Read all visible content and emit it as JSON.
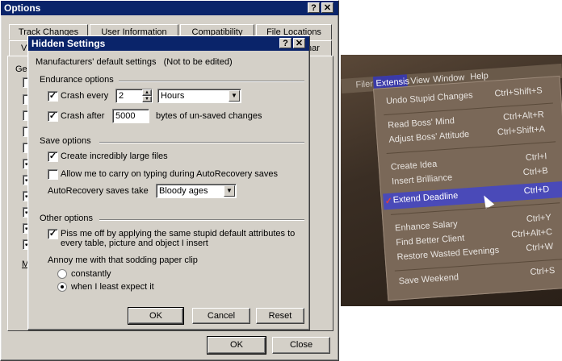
{
  "options": {
    "title": "Options",
    "help_btn": "?",
    "close_btn": "✕",
    "tabs_back": [
      "Track Changes",
      "User Information",
      "Compatibility",
      "File Locations"
    ],
    "tabs_front_partial": [
      "V",
      "nar"
    ],
    "general_partial": "Gen",
    "m_partial": "M",
    "ok": "OK",
    "close": "Close"
  },
  "hidden": {
    "title": "Hidden Settings",
    "help_btn": "?",
    "close_btn": "✕",
    "subtitle": "Manufacturers' default settings   (Not to be edited)",
    "endurance_label": "Endurance options",
    "crash_every_label": "Crash every",
    "crash_every_value": "2",
    "crash_every_unit": "Hours",
    "crash_after_label": "Crash after",
    "crash_after_value": "5000",
    "crash_after_suffix": "bytes of un-saved changes",
    "save_label": "Save options",
    "large_files_label": "Create incredibly large files",
    "allow_typing_label": "Allow me to carry on typing during AutoRecovery saves",
    "autorecovery_label": "AutoRecovery saves take",
    "autorecovery_value": "Bloody ages",
    "other_label": "Other options",
    "piss_label_1": "Piss me off by applying the same stupid default attributes to",
    "piss_label_2": "every table, picture and object I insert",
    "annoy_label": "Annoy me with that sodding paper clip",
    "radio_constantly": "constantly",
    "radio_least": "when I least expect it",
    "ok": "OK",
    "cancel": "Cancel",
    "reset": "Reset",
    "check_mark": "✓"
  },
  "photo": {
    "menubar": [
      "Filer",
      "Extensis",
      "View",
      "Window",
      "Help"
    ],
    "items": [
      {
        "label": "Undo Stupid Changes",
        "shortcut": "Ctrl+Shift+S"
      },
      {
        "label": "Read Boss' Mind",
        "shortcut": "Ctrl+Alt+R"
      },
      {
        "label": "Adjust Boss' Attitude",
        "shortcut": "Ctrl+Shift+A"
      },
      {
        "label": "Create Idea",
        "shortcut": "Ctrl+I"
      },
      {
        "label": "Insert Brilliance",
        "shortcut": "Ctrl+B"
      },
      {
        "label": "Extend Deadline",
        "shortcut": "Ctrl+D",
        "checked": true
      },
      {
        "label": "Enhance Salary",
        "shortcut": "Ctrl+Y"
      },
      {
        "label": "Find Better Client",
        "shortcut": "Ctrl+Alt+C"
      },
      {
        "label": "Restore Wasted Evenings",
        "shortcut": "Ctrl+W"
      },
      {
        "label": "Save Weekend",
        "shortcut": "Ctrl+S"
      }
    ],
    "check_mark": "✓",
    "highlight_color": "#4a4ab8"
  }
}
